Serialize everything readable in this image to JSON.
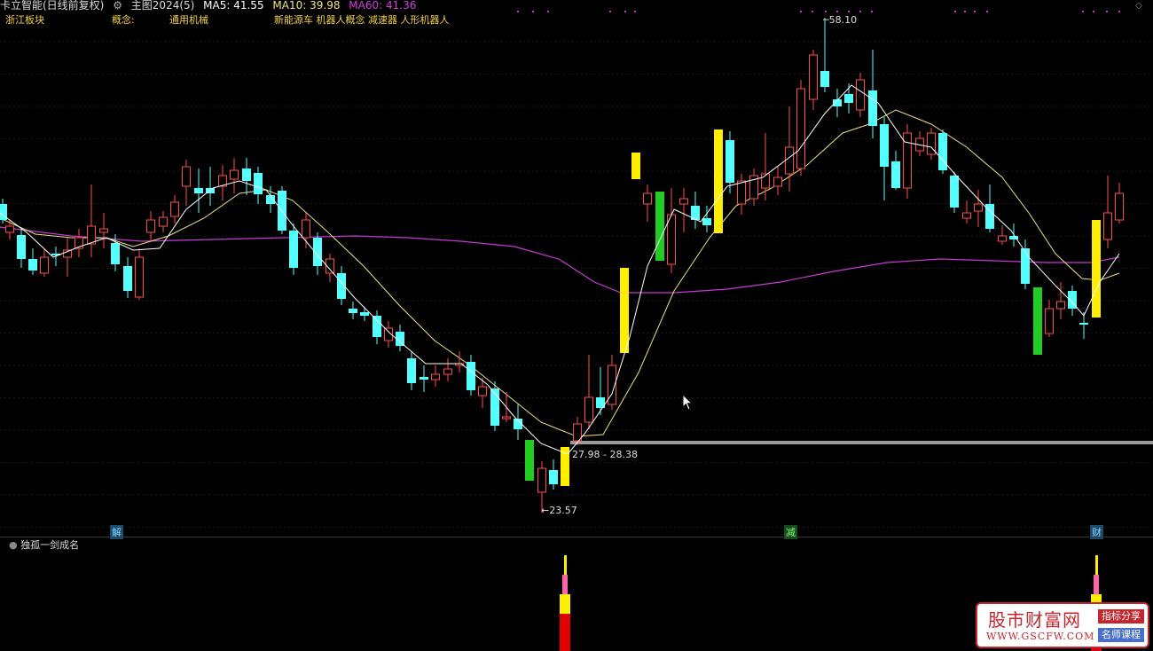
{
  "header": {
    "title": "卡立智能(日线前复权)",
    "indicator": "主图2024(5)",
    "ma5": "MA5: 41.55",
    "ma10": "MA10: 39.98",
    "ma60": "MA60: 41.36"
  },
  "info_row": {
    "sector": "浙江板块",
    "concept_label": "概念:",
    "industry": "通用机械",
    "concepts": "新能源车 机器人概念 减速器 人形机器人"
  },
  "annotations": {
    "high_label": "58.10",
    "low_label": "←23.57",
    "range_label": "27.98 - 28.38"
  },
  "events": [
    "解",
    "减",
    "财"
  ],
  "sub_panel": {
    "title": "独孤一剑成名"
  },
  "logo": {
    "name": "股市财富网",
    "url": "WWW.GSCFW.COM",
    "tag1": "指标分享",
    "tag2": "名师课程"
  },
  "colors": {
    "up": "#ff4b4b",
    "down": "#54ffff",
    "ma5": "#ffffff",
    "ma10": "#f0e27a",
    "ma60": "#c53ad3",
    "signal_yellow": "#ffee00",
    "signal_green": "#22cc22",
    "range_line": "#9a9a9a",
    "dots": "#d030d0"
  },
  "chart_data": {
    "type": "candlestick",
    "y_high": 58.1,
    "y_low": 23.57,
    "range_band": [
      27.98,
      28.38
    ]
  }
}
